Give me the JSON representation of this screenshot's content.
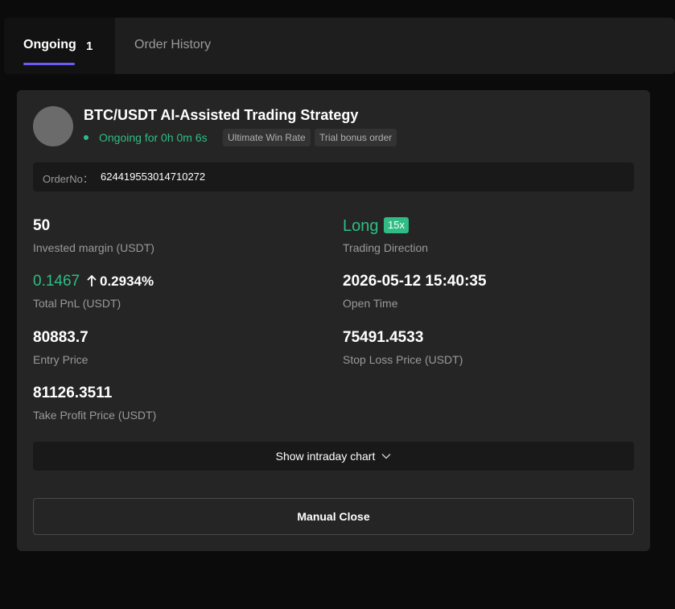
{
  "tabs": {
    "ongoing_label": "Ongoing",
    "ongoing_count": "1",
    "history_label": "Order History"
  },
  "order": {
    "title": "BTC/USDT AI-Assisted Trading Strategy",
    "status": "Ongoing for 0h 0m 6s",
    "tags": [
      "Ultimate Win Rate",
      "Trial bonus order"
    ],
    "order_no_label": "OrderNo：",
    "order_no": "624419553014710272",
    "invested_margin": "50",
    "invested_margin_label": "Invested margin (USDT)",
    "direction": "Long",
    "leverage": "15x",
    "direction_label": "Trading Direction",
    "total_pnl": "0.1467",
    "pnl_percent": "0.2934%",
    "total_pnl_label": "Total PnL (USDT)",
    "open_time": "2026-05-12 15:40:35",
    "open_time_label": "Open Time",
    "entry_price": "80883.7",
    "entry_price_label": "Entry Price",
    "stop_loss": "75491.4533",
    "stop_loss_label": "Stop Loss Price (USDT)",
    "take_profit": "81126.3511",
    "take_profit_label": "Take Profit Price (USDT)"
  },
  "actions": {
    "chart_toggle_label": "Show intraday chart",
    "manual_close_label": "Manual Close"
  },
  "colors": {
    "accent": "#6a5cf5",
    "positive": "#2fbd85",
    "card_bg": "#252525",
    "page_bg": "#0b0b0b"
  },
  "icons": {
    "pnl_arrow": "arrow-up-icon",
    "chart_toggle": "chevron-down-icon"
  }
}
